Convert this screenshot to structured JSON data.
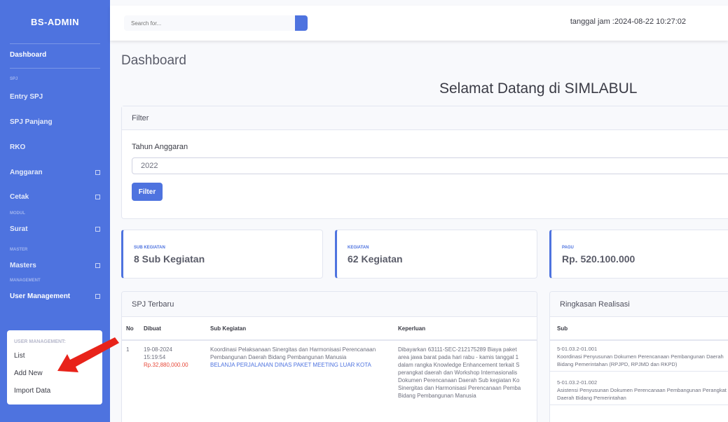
{
  "brand": "BS-ADMIN",
  "sidebar": {
    "dashboard": "Dashboard",
    "section_spj": "SPJ",
    "entry_spj": "Entry SPJ",
    "spj_panjang": "SPJ Panjang",
    "rko": "RKO",
    "anggaran": "Anggaran",
    "cetak": "Cetak",
    "section_modul": "MODUL",
    "surat": "Surat",
    "section_master": "MASTER",
    "masters": "Masters",
    "section_management": "MANAGEMENT",
    "user_management": "User Management",
    "submenu": {
      "header": "USER MANAGEMENT:",
      "items": [
        "List",
        "Add New",
        "Import Data"
      ]
    }
  },
  "topbar": {
    "search_placeholder": "Search for...",
    "datetime": "tanggal jam :2024-08-22 10:27:02"
  },
  "main": {
    "page_title": "Dashboard",
    "welcome": "Selamat Datang di SIMLABUL",
    "filter": {
      "header": "Filter",
      "label": "Tahun Anggaran",
      "selected": "2022",
      "button": "Filter"
    },
    "stats": [
      {
        "label": "SUB KEGIATAN",
        "value": "8 Sub Kegiatan"
      },
      {
        "label": "KEGIATAN",
        "value": "62 Kegiatan"
      },
      {
        "label": "PAGU",
        "value": "Rp. 520.100.000"
      }
    ],
    "spj": {
      "header": "SPJ Terbaru",
      "columns": [
        "No",
        "Dibuat",
        "Sub Kegiatan",
        "Keperluan"
      ],
      "rows": [
        {
          "no": "1",
          "date": "19-08-2024",
          "time": "15:19:54",
          "amount": "Rp.32,880,000.00",
          "sub_kegiatan": "Koordinasi Pelaksanaan Sinergitas dan Harmonisasi Perencanaan Pembangunan Daerah Bidang Pembangunan Manusia",
          "belanja": "BELANJA PERJALANAN DINAS PAKET MEETING LUAR KOTA",
          "keperluan": [
            "Dibayarkan 63111-SEC-212175289 Biaya paket",
            "area jawa barat pada hari rabu - kamis tanggal 1",
            "dalam rangka Knowledge Enhancement terkait S",
            "perangkat daerah dan Workshop Internasionalis",
            "Dokumen Perencanaan Daerah Sub kegiatan Ko",
            "Sinergitas dan Harmonisasi Perencanaan Pemba",
            "Bidang Pembangunan Manusia"
          ]
        }
      ]
    },
    "realisasi": {
      "header": "Ringkasan Realisasi",
      "column": "Sub",
      "items": [
        {
          "code": "5-01.03.2-01.001",
          "desc": "Koordinasi Penyusunan Dokumen Perencanaan Pembangunan Daerah Bidang Pemerintahan (RPJPD, RPJMD dan RKPD)"
        },
        {
          "code": "5-01.03.2-01.002",
          "desc": "Asistensi Penyusunan Dokumen Perencanaan Pembangunan Perangkat Daerah Bidang Pemerintahan"
        }
      ]
    }
  },
  "colors": {
    "primary": "#4e73df",
    "danger": "#e74a3b",
    "arrow": "#e8231a"
  }
}
